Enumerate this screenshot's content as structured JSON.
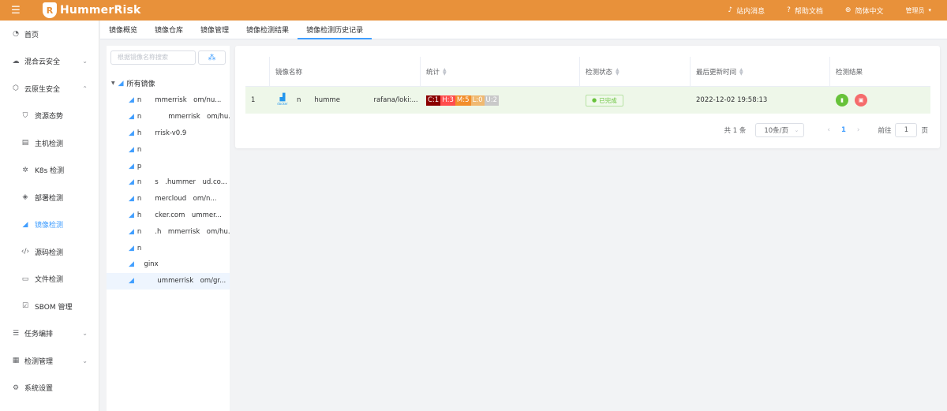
{
  "topbar": {
    "menu_icon": "hamburger-icon",
    "logo_text": "HummerRisk",
    "messages_label": "站内消息",
    "help_label": "帮助文档",
    "language_label": "简体中文",
    "user_label": "管理员"
  },
  "sidebar": {
    "items": [
      {
        "label": "首页",
        "icon": "dashboard-icon"
      },
      {
        "label": "混合云安全",
        "icon": "cloud-icon"
      },
      {
        "label": "云原生安全",
        "icon": "cube-icon"
      },
      {
        "label": "资源态势",
        "icon": "shield-icon"
      },
      {
        "label": "主机检测",
        "icon": "host-icon"
      },
      {
        "label": "K8s 检测",
        "icon": "k8s-icon"
      },
      {
        "label": "部署检测",
        "icon": "deploy-icon"
      },
      {
        "label": "镜像检测",
        "icon": "docker-icon"
      },
      {
        "label": "源码检测",
        "icon": "code-icon"
      },
      {
        "label": "文件检测",
        "icon": "file-icon"
      },
      {
        "label": "SBOM 管理",
        "icon": "sbom-icon"
      },
      {
        "label": "任务编排",
        "icon": "list-icon"
      },
      {
        "label": "检测管理",
        "icon": "grid-icon"
      },
      {
        "label": "系统设置",
        "icon": "settings-icon"
      }
    ]
  },
  "tabs": [
    "镜像概览",
    "镜像仓库",
    "镜像管理",
    "镜像检测结果",
    "镜像检测历史记录"
  ],
  "tree": {
    "search_placeholder": "根据镜像名称搜索",
    "root_label": "所有镜像",
    "items": [
      "n  mmerrisk om/nu...",
      "n    mmerrisk om/hu...",
      "h  rrisk-v0.9",
      "n  ",
      "p  ",
      "n  s .hummer ud.co...",
      "n  mercloud om/n...",
      "h  cker.com ummer...",
      "n  .h mmerrisk om/hu...",
      "n  ",
      " ginx",
      "   ummerrisk om/gr..."
    ]
  },
  "table": {
    "headers": [
      "",
      "镜像名称",
      "统计",
      "检测状态",
      "最后更新时间",
      "检测结果"
    ],
    "row": {
      "index": "1",
      "docker_label": "docker",
      "image_name": "n  humme     rafana/loki:...",
      "stats": {
        "c": "C:1",
        "h": "H:3",
        "m": "M:5",
        "l": "L:0",
        "u": "U:2"
      },
      "status": "已完成",
      "updated": "2022-12-02 19:58:13"
    }
  },
  "pagination": {
    "total": "共 1 条",
    "page_size": "10条/页",
    "current_page": "1",
    "goto_label": "前往",
    "goto_value": "1",
    "page_suffix": "页"
  },
  "colors": {
    "topbar": "#e8913a",
    "accent": "#409eff",
    "critical": "#8b0000",
    "high": "#ff4d4d",
    "medium": "#f28e2b",
    "low": "#f0b971",
    "unknown": "#c9c9c9",
    "success": "#67c23a"
  }
}
